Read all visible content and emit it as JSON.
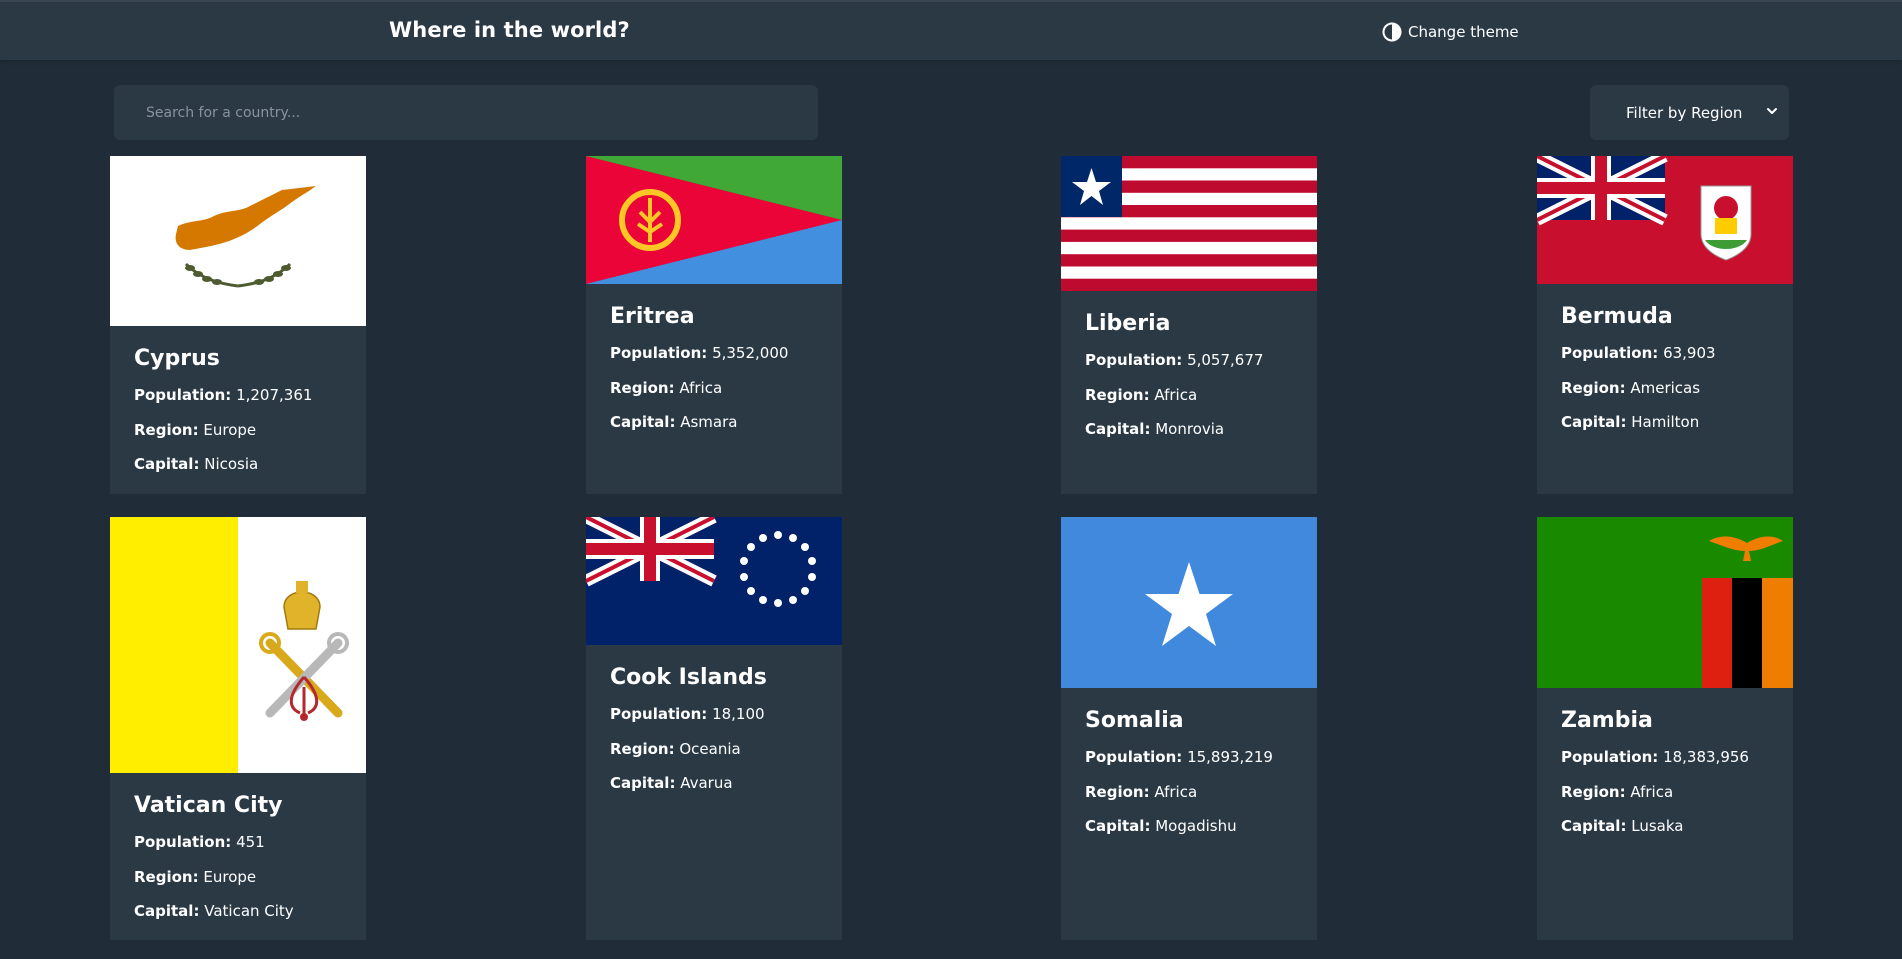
{
  "header": {
    "title": "Where in the world?",
    "theme_label": "Change theme"
  },
  "search": {
    "placeholder": "Search for a country..."
  },
  "filter": {
    "label": "Filter by Region"
  },
  "labels": {
    "population": "Population:",
    "region": "Region:",
    "capital": "Capital:"
  },
  "countries": [
    {
      "name": "Cyprus",
      "population": "1,207,361",
      "region": "Europe",
      "capital": "Nicosia"
    },
    {
      "name": "Eritrea",
      "population": "5,352,000",
      "region": "Africa",
      "capital": "Asmara"
    },
    {
      "name": "Liberia",
      "population": "5,057,677",
      "region": "Africa",
      "capital": "Monrovia"
    },
    {
      "name": "Bermuda",
      "population": "63,903",
      "region": "Americas",
      "capital": "Hamilton"
    },
    {
      "name": "Vatican City",
      "population": "451",
      "region": "Europe",
      "capital": "Vatican City"
    },
    {
      "name": "Cook Islands",
      "population": "18,100",
      "region": "Oceania",
      "capital": "Avarua"
    },
    {
      "name": "Somalia",
      "population": "15,893,219",
      "region": "Africa",
      "capital": "Mogadishu"
    },
    {
      "name": "Zambia",
      "population": "18,383,956",
      "region": "Africa",
      "capital": "Lusaka"
    }
  ],
  "colors": {
    "background": "#202c37",
    "element": "#2b3945",
    "text": "#ffffff"
  }
}
